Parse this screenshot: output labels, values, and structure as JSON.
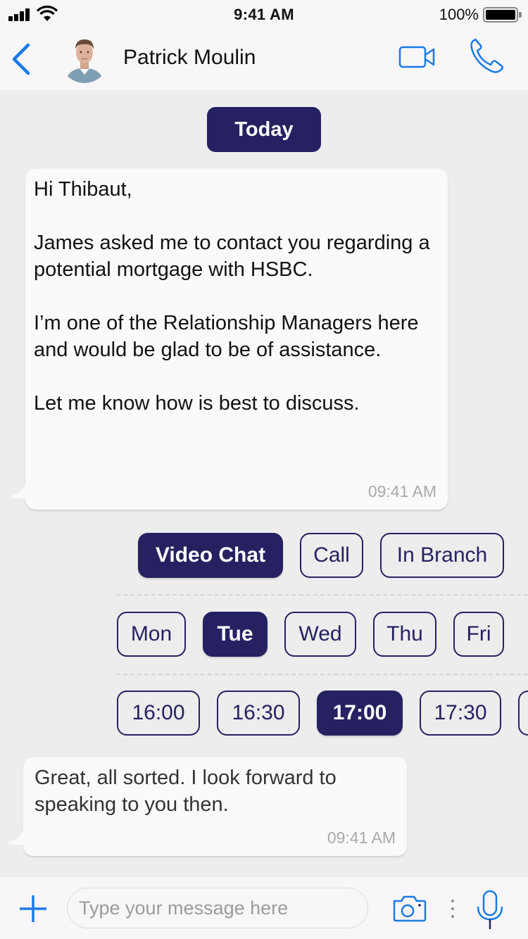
{
  "status_bar": {
    "time": "9:41 AM",
    "battery_percent": "100%",
    "battery_level": 1.0,
    "signal_bars": 4,
    "icons": [
      "signal-icon",
      "wifi-icon",
      "battery-icon"
    ]
  },
  "header": {
    "back_icon": "chevron-left-icon",
    "contact_name": "Patrick Moulin",
    "actions": [
      {
        "name": "video-call",
        "icon": "video-camera-icon"
      },
      {
        "name": "voice-call",
        "icon": "phone-icon"
      }
    ],
    "accent_color": "#1a7ae6"
  },
  "conversation": {
    "date_separator": "Today",
    "messages": [
      {
        "text": "Hi Thibaut,\n\nJames asked me to contact you regarding a potential mortgage with HSBC.\n\nI’m one of the Relationship Managers here and would be glad to be of assistance.\n\nLet me know how is best to discuss.",
        "time": "09:41 AM"
      },
      {
        "text": "Great, all sorted. I look forward to speaking to you then.",
        "time": "09:41 AM"
      }
    ],
    "quick_replies": {
      "methods": [
        {
          "label": "Video Chat",
          "selected": true
        },
        {
          "label": "Call",
          "selected": false
        },
        {
          "label": "In Branch",
          "selected": false
        }
      ],
      "days": [
        {
          "label": "Mon",
          "selected": false
        },
        {
          "label": "Tue",
          "selected": true
        },
        {
          "label": "Wed",
          "selected": false
        },
        {
          "label": "Thu",
          "selected": false
        },
        {
          "label": "Fri",
          "selected": false
        }
      ],
      "times": [
        {
          "label": "16:00",
          "selected": false
        },
        {
          "label": "16:30",
          "selected": false
        },
        {
          "label": "17:00",
          "selected": true
        },
        {
          "label": "17:30",
          "selected": false
        },
        {
          "label": "",
          "selected": false
        }
      ]
    },
    "brand_color": "#262261"
  },
  "composer": {
    "placeholder": "Type your message here",
    "value": "",
    "icons": [
      "plus-icon",
      "camera-icon",
      "more-vertical-icon",
      "microphone-icon"
    ]
  }
}
